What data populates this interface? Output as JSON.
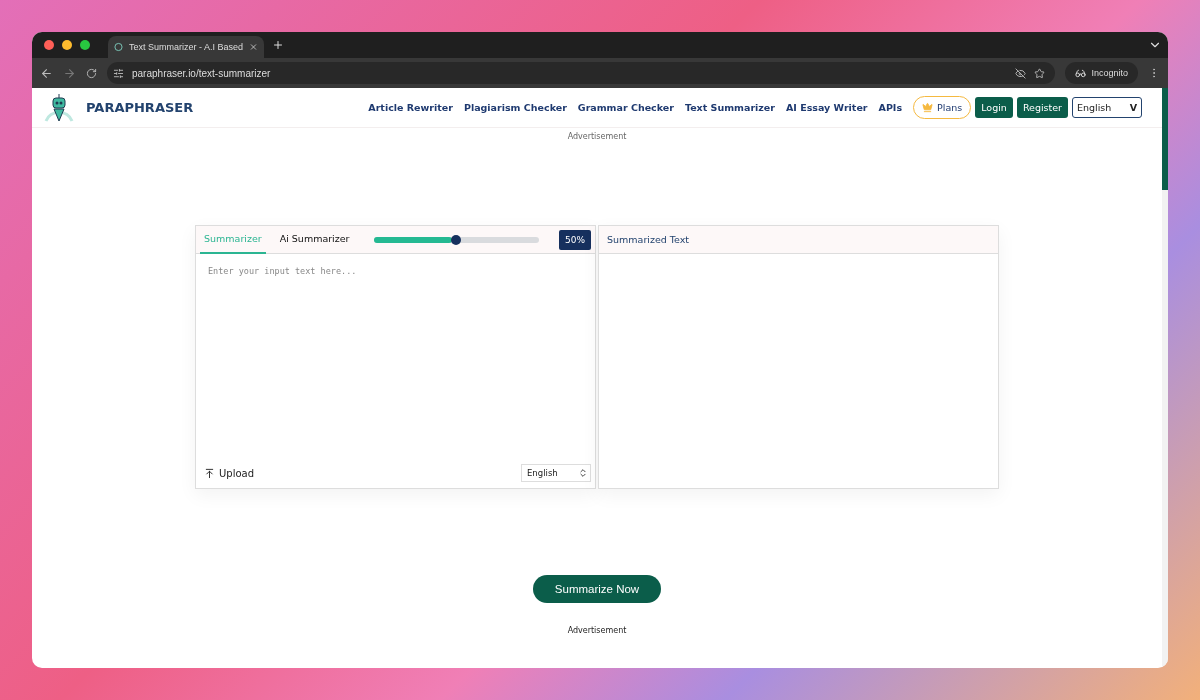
{
  "browser": {
    "tab_title": "Text Summarizer - A.I Based",
    "url": "paraphraser.io/text-summarizer",
    "profile": "Incognito"
  },
  "header": {
    "brand": "PARAPHRASER",
    "nav": [
      "Article Rewriter",
      "Plagiarism Checker",
      "Grammar Checker",
      "Text Summarizer",
      "AI Essay Writer",
      "APIs"
    ],
    "plans": "Plans",
    "login": "Login",
    "register": "Register",
    "language": "English",
    "language_caret": "V"
  },
  "ad_top": "Advertisement",
  "summarizer": {
    "tabs": [
      {
        "label": "Summarizer",
        "selected": true
      },
      {
        "label": "Ai Summarizer",
        "selected": false
      }
    ],
    "slider": {
      "level": 0.5,
      "reading": "50%"
    },
    "input": {
      "placeholder": "Enter your input text here..."
    },
    "upload": "Upload",
    "language": "English",
    "output_title": "Summarized Text"
  },
  "submit": "Summarize Now",
  "ad_bottom": "Advertisement"
}
